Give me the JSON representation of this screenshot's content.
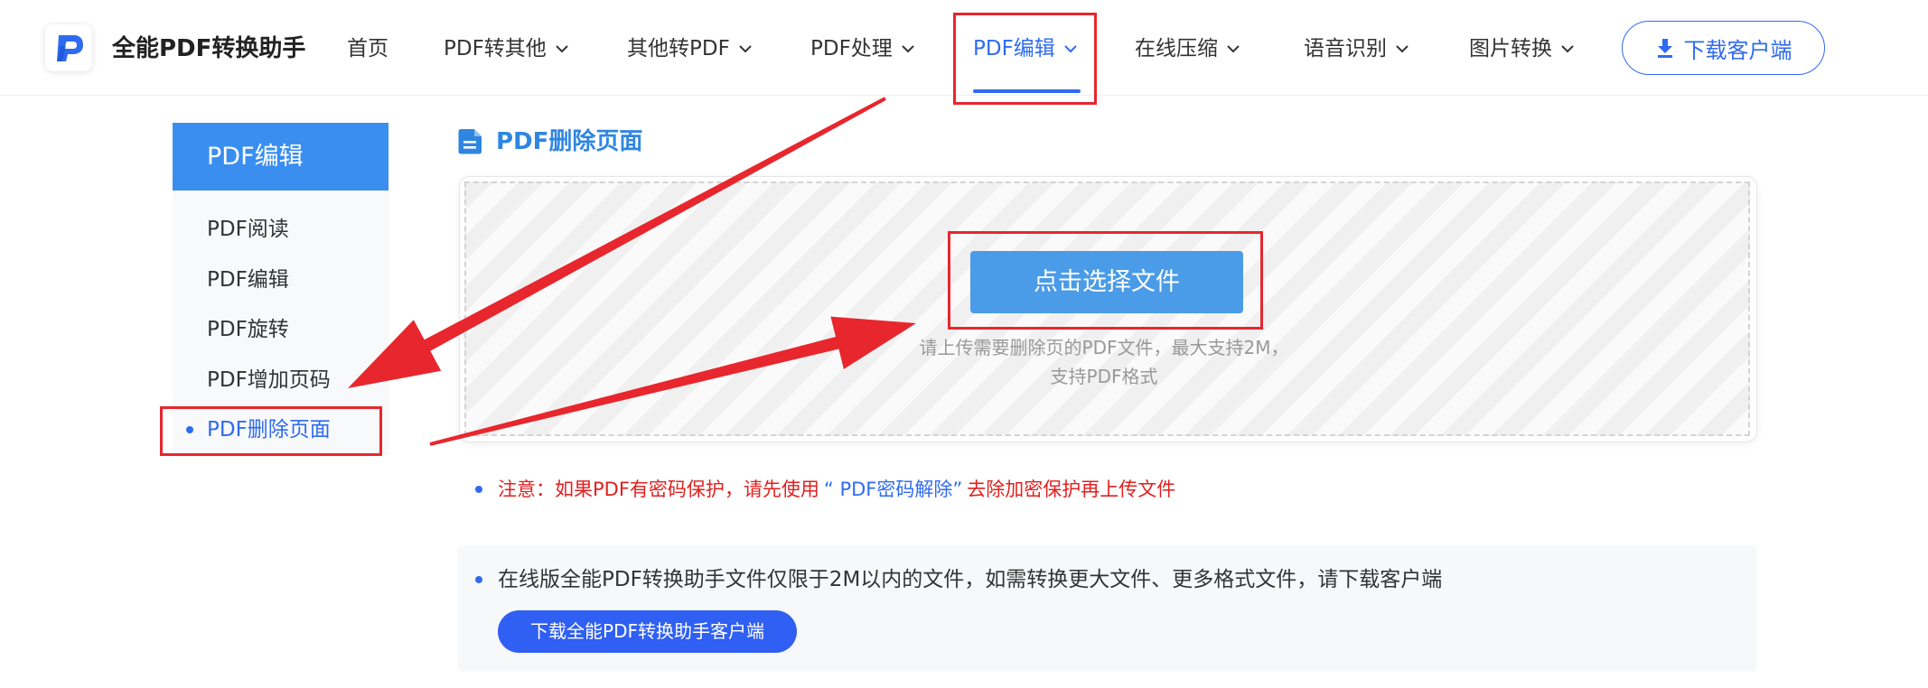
{
  "colors": {
    "primary": "#2f6bf0",
    "sidebar_header": "#3a8ef0",
    "title": "#2f86e0",
    "upload_button": "#4a9be8",
    "notice": "#e0201f",
    "promo_button": "#2f5ff3",
    "annotation": "#e8262d"
  },
  "brand": {
    "name": "全能PDF转换助手",
    "logo_icon": "pdf-logo-icon"
  },
  "nav": {
    "items": [
      {
        "label": "首页",
        "has_dropdown": false
      },
      {
        "label": "PDF转其他",
        "has_dropdown": true
      },
      {
        "label": "其他转PDF",
        "has_dropdown": true
      },
      {
        "label": "PDF处理",
        "has_dropdown": true
      },
      {
        "label": "PDF编辑",
        "has_dropdown": true,
        "active": true
      },
      {
        "label": "在线压缩",
        "has_dropdown": true
      },
      {
        "label": "语音识别",
        "has_dropdown": true
      },
      {
        "label": "图片转换",
        "has_dropdown": true
      }
    ],
    "download_button": {
      "label": "下载客户端",
      "icon": "download-icon"
    }
  },
  "sidebar": {
    "title": "PDF编辑",
    "items": [
      {
        "label": "PDF阅读"
      },
      {
        "label": "PDF编辑"
      },
      {
        "label": "PDF旋转"
      },
      {
        "label": "PDF增加页码"
      },
      {
        "label": "PDF删除页面",
        "active": true
      }
    ]
  },
  "main": {
    "title": "PDF删除页面",
    "title_icon": "document-icon",
    "upload": {
      "button_label": "点击选择文件",
      "hint_line1": "请上传需要删除页的PDF文件，最大支持2M，",
      "hint_line2": "支持PDF格式"
    },
    "notice": {
      "prefix": "注意：如果PDF有密码保护，请先使用",
      "link": "“ PDF密码解除”",
      "suffix": "去除加密保护再上传文件"
    },
    "promo": {
      "text": "在线版全能PDF转换助手文件仅限于2M以内的文件，如需转换更大文件、更多格式文件，请下载客户端",
      "button_label": "下载全能PDF转换助手客户端"
    }
  }
}
